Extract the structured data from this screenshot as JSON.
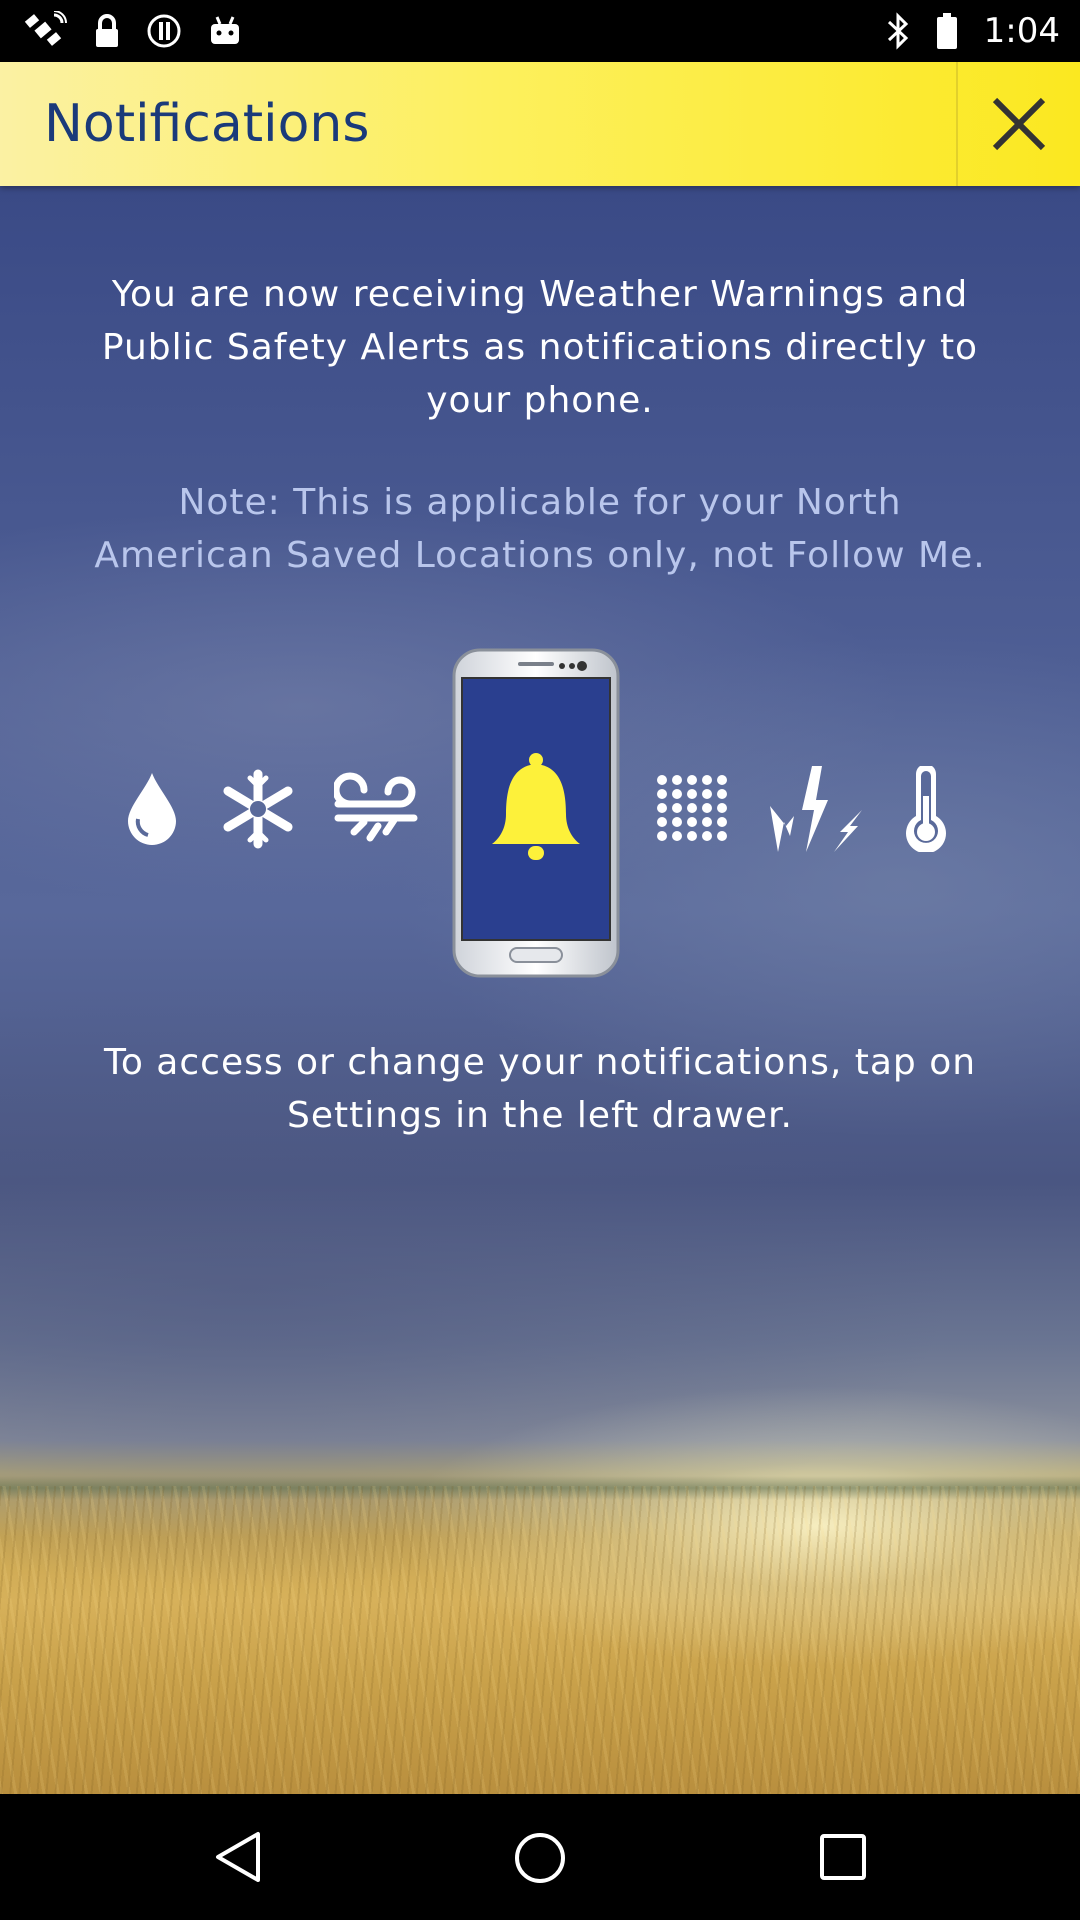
{
  "status_bar": {
    "time": "1:04",
    "left_icons": [
      "satellite-icon",
      "lock-icon",
      "sync-icon",
      "android-icon"
    ],
    "right_icons": [
      "bluetooth-icon",
      "battery-icon"
    ]
  },
  "header": {
    "title": "Notifications",
    "close_icon": "close-icon",
    "background_color": "#fdf05e",
    "title_color": "#1a3a7a"
  },
  "main": {
    "intro_text": "You are now receiving Weather Warnings and Public Safety Alerts as notifications directly to your phone.",
    "note_text": "Note: This is applicable for your North American Saved Locations only, not Follow Me.",
    "access_text": "To access or change your notifications, tap on Settings in the left drawer.",
    "note_color": "#b9c6ec",
    "weather_icons": [
      "raindrop-icon",
      "snowflake-icon",
      "wind-icon",
      "phone-bell-icon",
      "hail-icon",
      "lightning-icon",
      "thermometer-icon"
    ],
    "bell_color": "#fdf13a"
  },
  "nav_bar": {
    "buttons": [
      "back-icon",
      "home-icon",
      "recents-icon"
    ]
  }
}
